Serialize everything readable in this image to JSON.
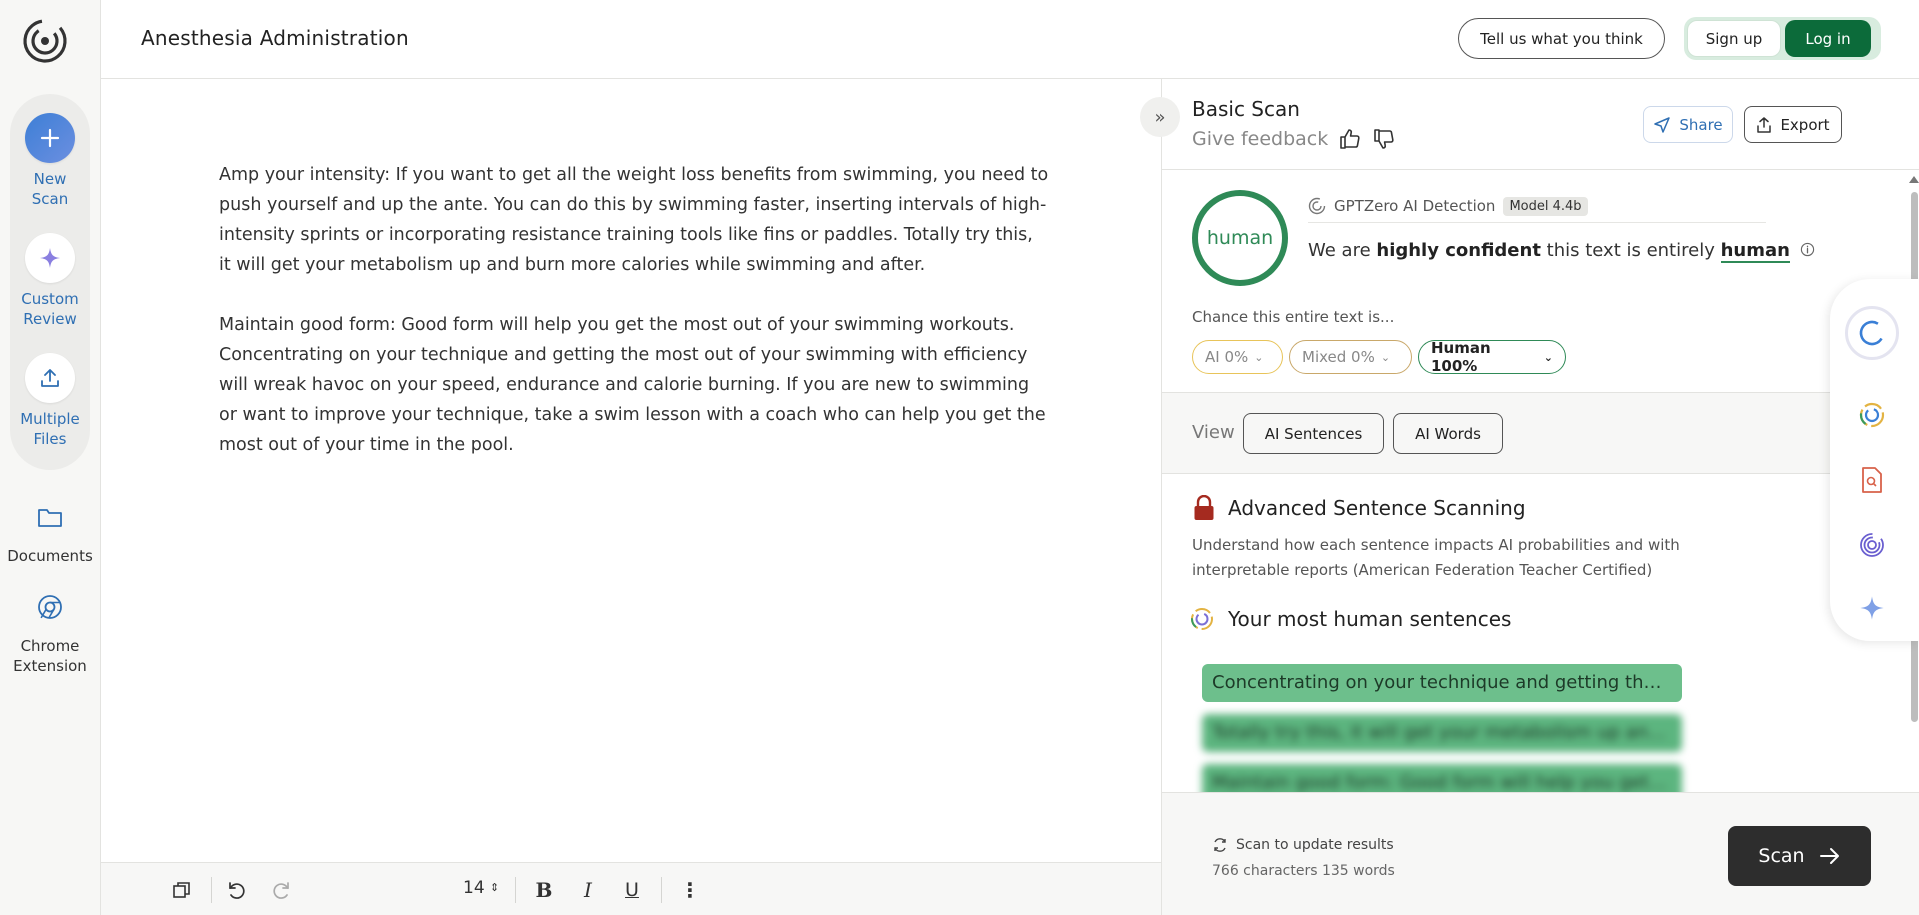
{
  "rail": {
    "new_scan": "New\nScan",
    "new_scan_lines": [
      "New",
      "Scan"
    ],
    "custom_review_lines": [
      "Custom",
      "Review"
    ],
    "multiple_files_lines": [
      "Multiple",
      "Files"
    ],
    "documents": "Documents",
    "chrome_extension_lines": [
      "Chrome",
      "Extension"
    ]
  },
  "header": {
    "document_title": "Anesthesia Administration",
    "feedback_label": "Tell us what you think",
    "signup_label": "Sign up",
    "login_label": "Log in"
  },
  "editor": {
    "paragraphs": [
      "Amp your intensity: If you want to get all the weight loss benefits from swimming, you need to push yourself and up the ante. You can do this by swimming faster, inserting intervals of high-intensity sprints or incorporating resistance training tools like fins or paddles. Totally try this, it will get your metabolism up and burn more calories while swimming and after.",
      "Maintain good form: Good form will help you get the most out of your swimming workouts. Concentrating on your technique and getting the most out of your swimming with efficiency will wreak havoc on your speed, endurance and calorie burning. If you are new to swimming or want to improve your technique, take a swim lesson with a coach who can help you get the most out of your time in the pool."
    ]
  },
  "toolbar": {
    "font_size": "14"
  },
  "panel": {
    "title": "Basic Scan",
    "give_feedback": "Give feedback",
    "share_label": "Share",
    "export_label": "Export",
    "result_label": "human",
    "detector_name": "GPTZero AI Detection",
    "model_badge": "Model 4.4b",
    "confidence_prefix": "We are ",
    "confidence_strong": "highly confident",
    "confidence_middle": " this text is entirely ",
    "confidence_result": "human",
    "chance_label": "Chance this entire text is...",
    "pills": {
      "ai": "AI 0%",
      "mixed": "Mixed 0%",
      "human": "Human 100%"
    },
    "view_label": "View",
    "view_ai_sentences": "AI Sentences",
    "view_ai_words": "AI Words",
    "advanced_title": "Advanced Sentence Scanning",
    "advanced_desc": "Understand how each sentence impacts AI probabilities and with interpretable reports (American Federation Teacher Certified)",
    "most_human_title": "Your most human sentences",
    "sentences": [
      "Concentrating on your technique and getting the m...",
      "Totally try this, it will get your metabolism up and b...",
      "Maintain good form: Good form will help you get th..."
    ],
    "footer_status": "Scan to update results",
    "footer_count": "766 characters 135 words",
    "scan_label": "Scan"
  },
  "colors": {
    "brand_green": "#0c6b3a",
    "human_green": "#2f8a57",
    "link_blue": "#2f6fb3"
  }
}
